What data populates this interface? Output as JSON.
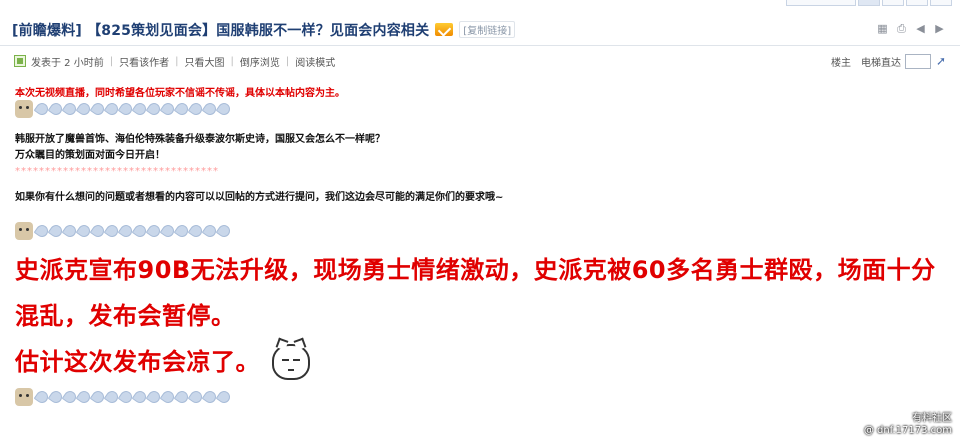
{
  "window": {
    "tabs_count": 5
  },
  "header": {
    "title": "[前瞻爆料] 【825策划见面会】国服韩服不一样？见面会内容相关",
    "copy_link": "[复制链接]",
    "tool_icons": [
      "qr-icon",
      "print-icon",
      "prev-icon",
      "next-icon"
    ]
  },
  "meta": {
    "posted": "发表于 2 小时前",
    "author_only": "只看该作者",
    "big_image": "只看大图",
    "reverse": "倒序浏览",
    "read_mode": "阅读模式",
    "floor_owner": "楼主",
    "jump_label": "电梯直达",
    "jump_input_value": ""
  },
  "post": {
    "notice": "本次无视频直播，同时希望各位玩家不信谣不传谣，具体以本帖内容为主。",
    "para1_line1": "韩服开放了魔兽首饰、海伯伦特殊装备升级泰波尔斯史诗，国服又会怎么不一样呢？",
    "para1_line2": "万众瞩目的策划面对面今日开启！",
    "stars": "**********************************",
    "para2": "如果你有什么想问的问题或者想看的内容可以以回帖的方式进行提问，我们这边会尽可能的满足你们的要求哦~",
    "big_line1": "史派克宣布90B无法升级，现场勇士情绪激动，史派克被60多名勇士群殴，场面十分",
    "big_line2": "混乱，发布会暂停。",
    "big_line3": "估计这次发布会凉了。"
  },
  "watermark": {
    "line1": "有料社区",
    "line2": "@ dnf.17173.com"
  },
  "colors": {
    "title": "#1f3f73",
    "red": "#e00000",
    "stars": "#ff9c9c"
  }
}
